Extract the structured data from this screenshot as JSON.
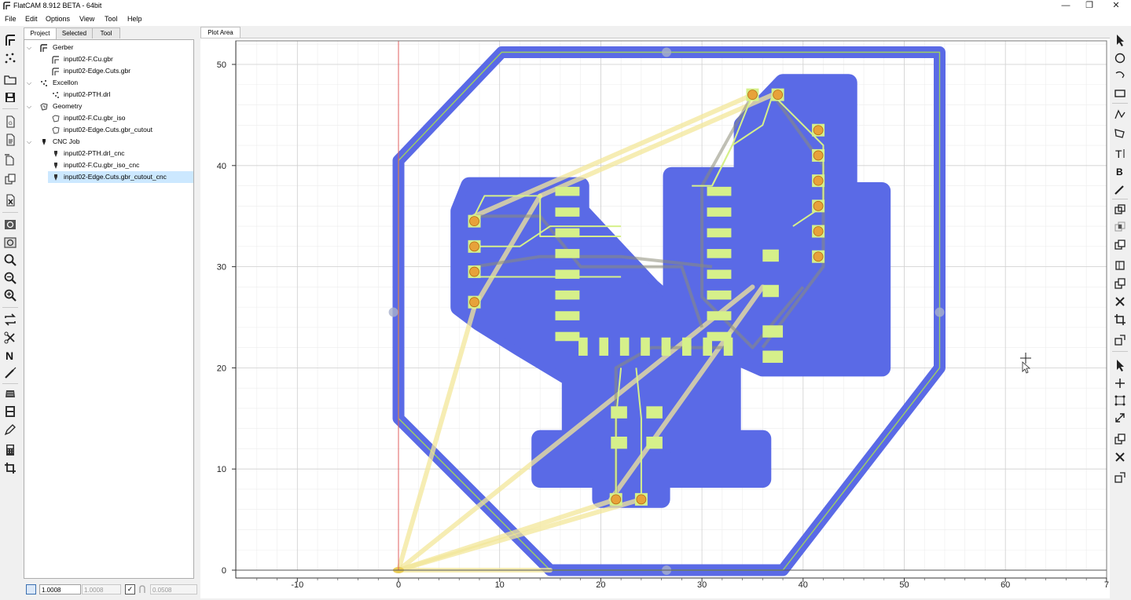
{
  "window": {
    "title": "FlatCAM 8.912 BETA - 64bit",
    "minimize": "—",
    "maximize": "❐",
    "close": "✕"
  },
  "menu": [
    "File",
    "Edit",
    "Options",
    "View",
    "Tool",
    "Help"
  ],
  "dock": {
    "tabs": [
      "Project",
      "Selected",
      "Tool"
    ],
    "active_tab": "Project"
  },
  "tree": {
    "groups": [
      {
        "label": "Gerber",
        "icon": "gerber-icon",
        "items": [
          "input02-F.Cu.gbr",
          "input02-Edge.Cuts.gbr"
        ]
      },
      {
        "label": "Excellon",
        "icon": "excellon-icon",
        "items": [
          "input02-PTH.drl"
        ]
      },
      {
        "label": "Geometry",
        "icon": "geometry-icon",
        "items": [
          "input02-F.Cu.gbr_iso",
          "input02-Edge.Cuts.gbr_cutout"
        ]
      },
      {
        "label": "CNC Job",
        "icon": "cnc-icon",
        "items": [
          "input02-PTH.drl_cnc",
          "input02-F.Cu.gbr_iso_cnc",
          "input02-Edge.Cuts.gbr_cutout_cnc"
        ]
      }
    ],
    "selected": "input02-Edge.Cuts.gbr_cutout_cnc"
  },
  "status": {
    "snap_value": "1.0008",
    "snap_value_2": "1.0008",
    "grid_value": "0.0508"
  },
  "plot": {
    "tab_label": "Plot Area",
    "x_ticks": [
      "-10",
      "0",
      "10",
      "20",
      "30",
      "40",
      "50",
      "60",
      "7"
    ],
    "y_ticks": [
      "0",
      "10",
      "20",
      "30",
      "40",
      "50"
    ],
    "colors": {
      "isolation": "#5a6ae6",
      "copper": "#d6f08a",
      "outline": "#9ed060",
      "drill_pad": "#e7a23a",
      "travel": "#f3e79a",
      "cut": "#8c8c78",
      "axis": "#e06060",
      "grid_major": "#d0d0d0",
      "grid_minor": "#ececec"
    }
  }
}
